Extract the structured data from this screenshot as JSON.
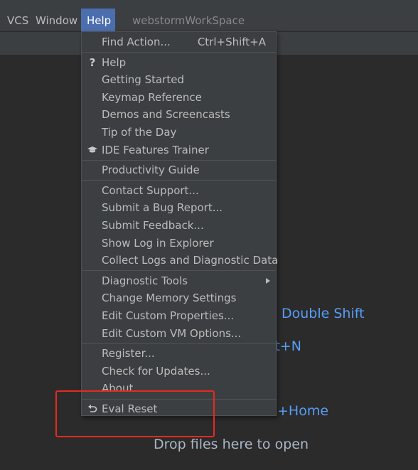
{
  "menubar": {
    "items": [
      {
        "label": "VCS",
        "active": false
      },
      {
        "label": "Window",
        "active": false
      },
      {
        "label": "Help",
        "active": true
      }
    ],
    "project_name": "webstormWorkSpace"
  },
  "help_menu": {
    "groups": [
      [
        {
          "label": "Find Action...",
          "shortcut": "Ctrl+Shift+A"
        }
      ],
      [
        {
          "label": "Help",
          "icon": "question-mark-icon"
        },
        {
          "label": "Getting Started"
        },
        {
          "label": "Keymap Reference"
        },
        {
          "label": "Demos and Screencasts"
        },
        {
          "label": "Tip of the Day"
        },
        {
          "label": "IDE Features Trainer",
          "icon": "graduation-cap-icon"
        }
      ],
      [
        {
          "label": "Productivity Guide"
        }
      ],
      [
        {
          "label": "Contact Support..."
        },
        {
          "label": "Submit a Bug Report..."
        },
        {
          "label": "Submit Feedback..."
        },
        {
          "label": "Show Log in Explorer"
        },
        {
          "label": "Collect Logs and Diagnostic Data"
        }
      ],
      [
        {
          "label": "Diagnostic Tools",
          "submenu": true
        },
        {
          "label": "Change Memory Settings"
        },
        {
          "label": "Edit Custom Properties..."
        },
        {
          "label": "Edit Custom VM Options..."
        }
      ],
      [
        {
          "label": "Register..."
        },
        {
          "label": "Check for Updates..."
        },
        {
          "label": "About"
        }
      ],
      [
        {
          "label": "Eval Reset",
          "icon": "undo-arrow-icon"
        }
      ]
    ]
  },
  "welcome_hints": {
    "double_shift": "Double Shift",
    "shift_n": "ft+N",
    "home": "+Home",
    "drop_files": "Drop files here to open"
  },
  "colors": {
    "menu_bg": "#3c3f41",
    "editor_bg": "#2b2b2b",
    "active_menu": "#4b6eaf",
    "hint_blue": "#589df6",
    "annotation_red": "#e8291e"
  }
}
